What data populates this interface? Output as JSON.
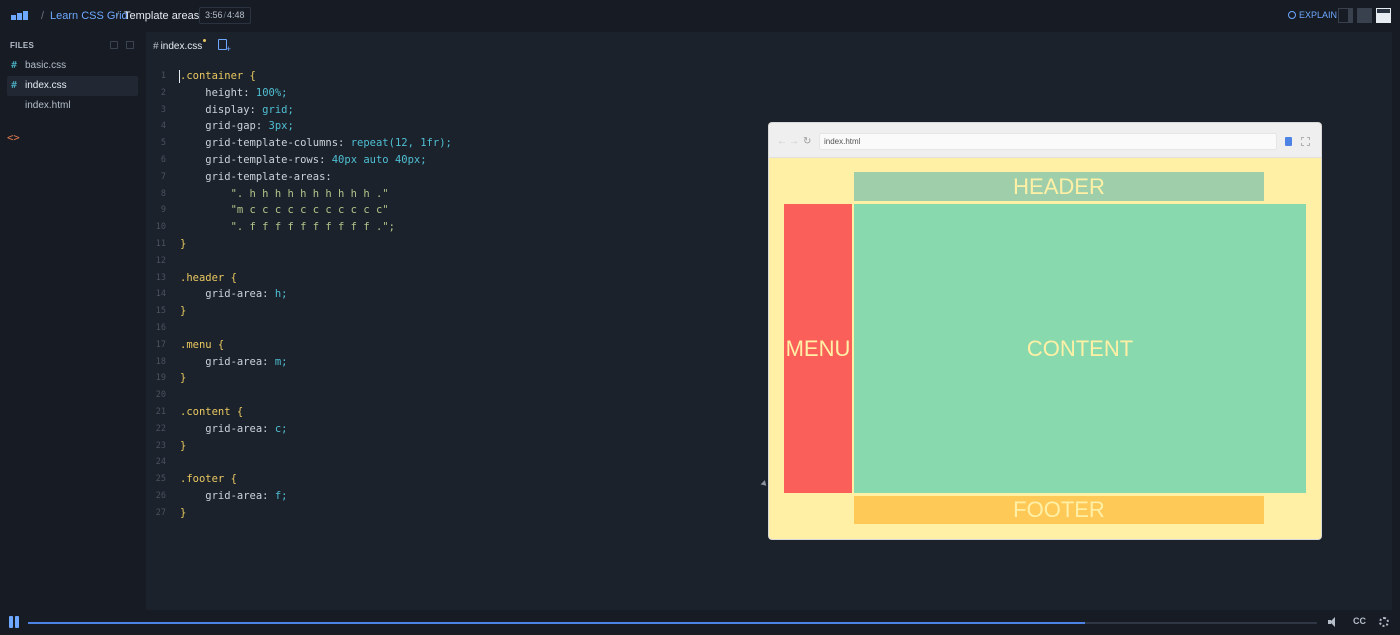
{
  "topbar": {
    "breadcrumb": [
      "Learn CSS Grid",
      "Template areas"
    ],
    "separator": "/",
    "time_current": "3:56",
    "time_total": "4:48",
    "time_divider": "/",
    "explain_label": "EXPLAIN"
  },
  "sidebar": {
    "title": "FILES",
    "files": [
      {
        "icon": "#",
        "name": "basic.css"
      },
      {
        "icon": "#",
        "name": "index.css"
      },
      {
        "icon": "<>",
        "name": "index.html"
      }
    ]
  },
  "editor": {
    "tab_icon": "#",
    "tab_name": "index.css",
    "code": [
      {
        "n": "1",
        "t": ".container {"
      },
      {
        "n": "2",
        "t": "    height: 100%;"
      },
      {
        "n": "3",
        "t": "    display: grid;"
      },
      {
        "n": "4",
        "t": "    grid-gap: 3px;"
      },
      {
        "n": "5",
        "t": "    grid-template-columns: repeat(12, 1fr);"
      },
      {
        "n": "6",
        "t": "    grid-template-rows: 40px auto 40px;"
      },
      {
        "n": "7",
        "t": "    grid-template-areas:"
      },
      {
        "n": "8",
        "t": "        \". h h h h h h h h h h .\""
      },
      {
        "n": "9",
        "t": "        \"m c c c c c c c c c c c\""
      },
      {
        "n": "10",
        "t": "        \". f f f f f f f f f f .\";"
      },
      {
        "n": "11",
        "t": "}"
      },
      {
        "n": "12",
        "t": ""
      },
      {
        "n": "13",
        "t": ".header {"
      },
      {
        "n": "14",
        "t": "    grid-area: h;"
      },
      {
        "n": "15",
        "t": "}"
      },
      {
        "n": "16",
        "t": ""
      },
      {
        "n": "17",
        "t": ".menu {"
      },
      {
        "n": "18",
        "t": "    grid-area: m;"
      },
      {
        "n": "19",
        "t": "}"
      },
      {
        "n": "20",
        "t": ""
      },
      {
        "n": "21",
        "t": ".content {"
      },
      {
        "n": "22",
        "t": "    grid-area: c;"
      },
      {
        "n": "23",
        "t": "}"
      },
      {
        "n": "24",
        "t": ""
      },
      {
        "n": "25",
        "t": ".footer {"
      },
      {
        "n": "26",
        "t": "    grid-area: f;"
      },
      {
        "n": "27",
        "t": "}"
      }
    ]
  },
  "preview": {
    "nav_back": "←",
    "nav_forward": "→",
    "reload": "↻",
    "url": "index.html",
    "areas": {
      "header": "HEADER",
      "menu": "MENU",
      "content": "CONTENT",
      "footer": "FOOTER"
    }
  },
  "player": {
    "progress": 0.82,
    "cc_label": "CC"
  },
  "colors": {
    "accent": "#6ea8ff",
    "preview_bg": "#fff0a6",
    "header_bg": "#9fcfaa",
    "menu_bg": "#fb5f59",
    "content_bg": "#89d9ae",
    "footer_bg": "#ffc957",
    "syntax_selector": "#e8c860",
    "syntax_value": "#4ebfd3",
    "syntax_string": "#b3c48a"
  }
}
